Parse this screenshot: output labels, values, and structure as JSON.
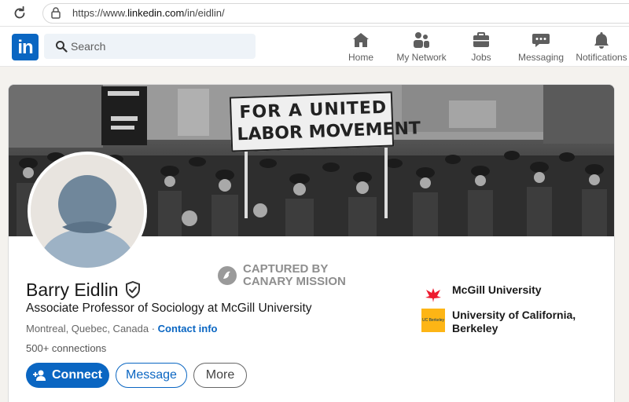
{
  "browser": {
    "url_prefix": "https://www.",
    "url_domain": "linkedin.com",
    "url_path": "/in/eidlin/"
  },
  "header": {
    "logo": "in",
    "search": {
      "placeholder": "Search"
    },
    "nav": [
      {
        "label": "Home",
        "icon": "home-icon"
      },
      {
        "label": "My Network",
        "icon": "network-icon"
      },
      {
        "label": "Jobs",
        "icon": "briefcase-icon"
      },
      {
        "label": "Messaging",
        "icon": "chat-icon"
      },
      {
        "label": "Notifications",
        "icon": "bell-icon"
      }
    ]
  },
  "banner": {
    "sign_line1": "FOR A UNITED",
    "sign_line2": "LABOR MOVEMENT"
  },
  "watermark": {
    "line1": "CAPTURED BY",
    "line2": "CANARY MISSION"
  },
  "profile": {
    "name": "Barry Eidlin",
    "headline": "Associate Professor of Sociology at McGill University",
    "location": "Montreal, Quebec, Canada",
    "separator": " · ",
    "contact_info": "Contact info",
    "connections": "500+ connections"
  },
  "actions": {
    "connect": "Connect",
    "message": "Message",
    "more": "More"
  },
  "education": [
    {
      "name": "McGill University",
      "logo_color": "#ed1b2f"
    },
    {
      "name": "University of California, Berkeley",
      "logo_text": "UC Berkeley",
      "logo_color": "#fdb515"
    }
  ],
  "colors": {
    "linkedin_blue": "#0a66c2",
    "page_bg": "#f4f2ee"
  }
}
